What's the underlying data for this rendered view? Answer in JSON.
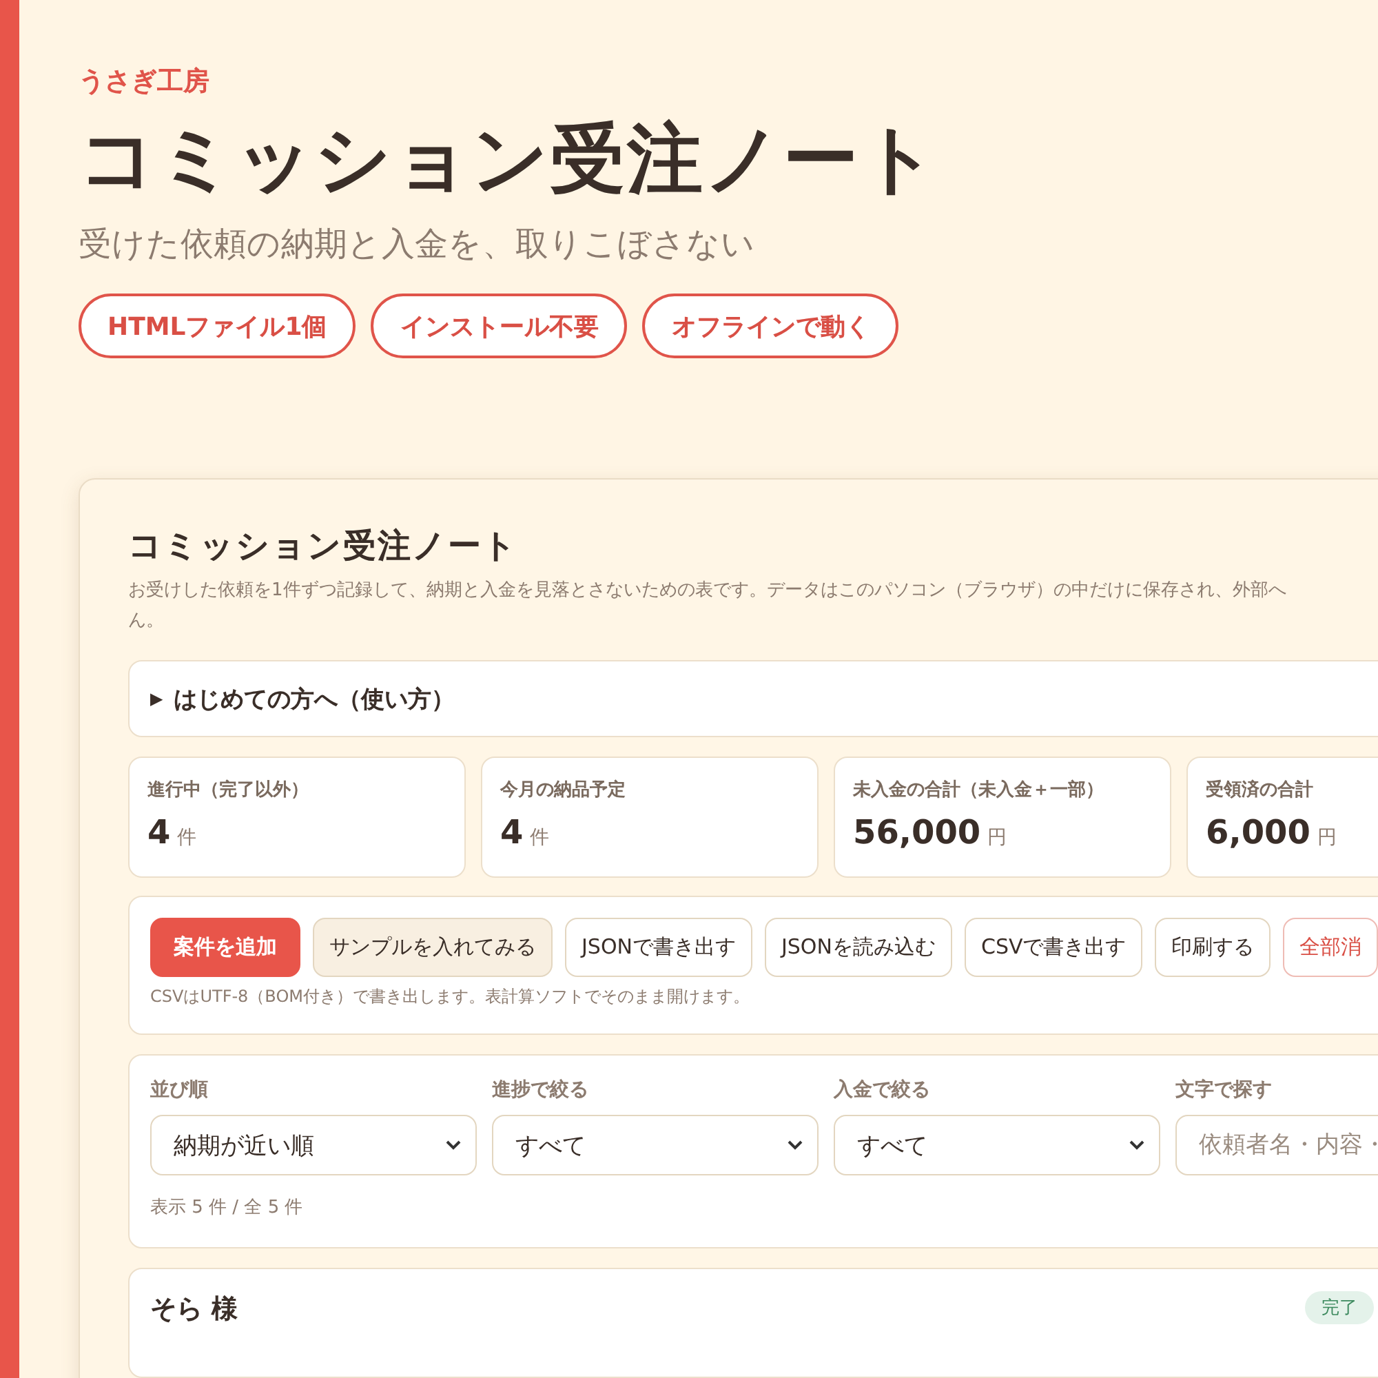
{
  "hero": {
    "brand": "うさぎ工房",
    "title": "コミッション受注ノート",
    "subtitle": "受けた依頼の納期と入金を、取りこぼさない",
    "pills": [
      "HTMLファイル1個",
      "インストール不要",
      "オフラインで動く"
    ]
  },
  "app": {
    "title": "コミッション受注ノート",
    "description_lines": [
      "お受けした依頼を1件ずつ記録して、納期と入金を見落とさないための表です。データはこのパソコン（ブラウザ）の中だけに保存され、外部へ",
      "ん。"
    ],
    "guide": {
      "marker": "▶",
      "label": "はじめての方へ（使い方）",
      "expanded": false
    },
    "stats": [
      {
        "label": "進行中（完了以外）",
        "value": "4",
        "unit": "件"
      },
      {
        "label": "今月の納品予定",
        "value": "4",
        "unit": "件"
      },
      {
        "label": "未入金の合計（未入金＋一部）",
        "value": "56,000",
        "unit": "円"
      },
      {
        "label": "受領済の合計",
        "value": "6,000",
        "unit": "円"
      }
    ],
    "actions": [
      {
        "label": "案件を追加",
        "kind": "primary"
      },
      {
        "label": "サンプルを入れてみる",
        "kind": "soft"
      },
      {
        "label": "JSONで書き出す",
        "kind": "plain"
      },
      {
        "label": "JSONを読み込む",
        "kind": "plain"
      },
      {
        "label": "CSVで書き出す",
        "kind": "plain"
      },
      {
        "label": "印刷する",
        "kind": "plain"
      },
      {
        "label": "全部消",
        "kind": "danger"
      }
    ],
    "csv_note": "CSVはUTF-8（BOM付き）で書き出します。表計算ソフトでそのまま開けます。",
    "filters": [
      {
        "label": "並び順",
        "kind": "select",
        "value": "納期が近い順"
      },
      {
        "label": "進捗で絞る",
        "kind": "select",
        "value": "すべて"
      },
      {
        "label": "入金で絞る",
        "kind": "select",
        "value": "すべて"
      },
      {
        "label": "文字で探す",
        "kind": "search",
        "placeholder": "依頼者名・内容・"
      }
    ],
    "count": "表示 5 件 / 全 5 件",
    "orders": [
      {
        "client": "そら 様",
        "badge": "完了"
      }
    ]
  }
}
